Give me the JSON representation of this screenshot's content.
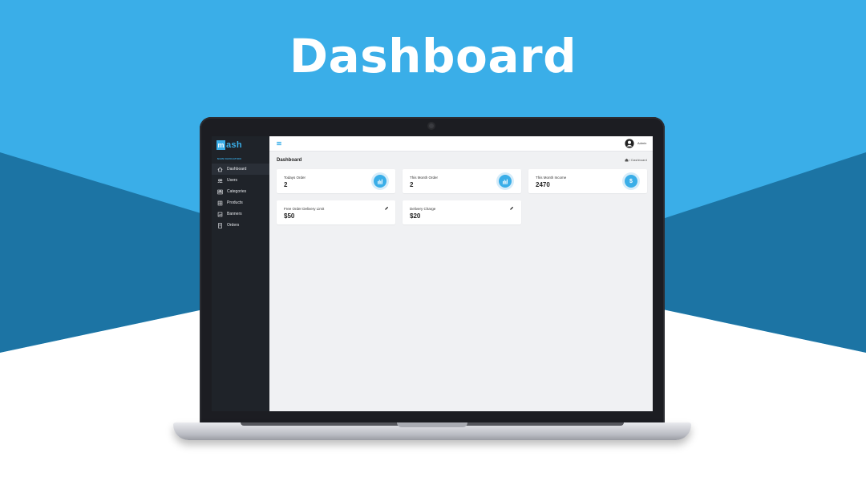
{
  "hero": {
    "title": "Dashboard"
  },
  "app": {
    "logo_box": "m",
    "logo_rest": "ash",
    "nav_header": "MAIN NAVIGATION",
    "nav_items": [
      {
        "label": "Dashboard",
        "icon": "home-icon",
        "active": true
      },
      {
        "label": "Users",
        "icon": "users-icon",
        "active": false
      },
      {
        "label": "Categories",
        "icon": "categories-icon",
        "active": false
      },
      {
        "label": "Products",
        "icon": "products-icon",
        "active": false
      },
      {
        "label": "Banners",
        "icon": "banners-icon",
        "active": false
      },
      {
        "label": "Orders",
        "icon": "orders-icon",
        "active": false
      }
    ],
    "topbar": {
      "user_name": "Admin"
    },
    "page_title": "Dashboard",
    "breadcrumb": "/ Dashboard",
    "cards": [
      {
        "label": "Todays Order",
        "value": "2",
        "icon": "bar-chart-icon"
      },
      {
        "label": "This Month Order",
        "value": "2",
        "icon": "bar-chart-icon"
      },
      {
        "label": "This Month Income",
        "value": "2470",
        "icon": "dollar-icon"
      },
      {
        "label": "Free Order Delivery Limit",
        "value": "$50",
        "icon": "pencil-icon"
      },
      {
        "label": "Delivery Charge",
        "value": "$20",
        "icon": "pencil-icon"
      }
    ]
  },
  "colors": {
    "sky": "#3aaee8",
    "band": "#1c74a4",
    "sidebar": "#1f2329",
    "content_bg": "#f0f1f3"
  }
}
